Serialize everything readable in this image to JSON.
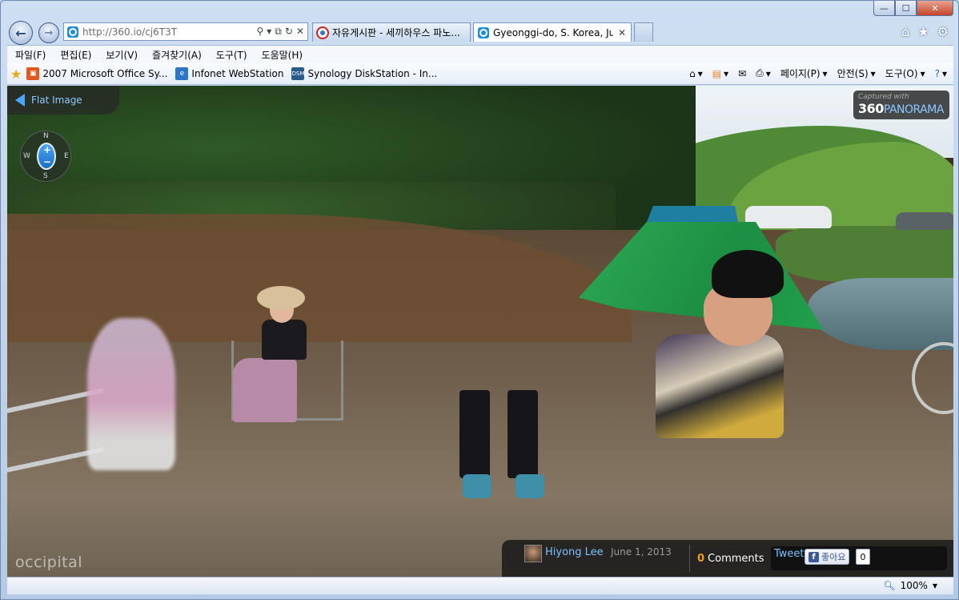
{
  "window": {
    "minimize_glyph": "—",
    "maximize_glyph": "☐",
    "close_glyph": "✕"
  },
  "nav": {
    "url": "http://360.io/cj6T3T",
    "back_glyph": "←",
    "forward_glyph": "→"
  },
  "tabs": [
    {
      "label": "자유게시판 - 세끼하우스 파노...",
      "active": false
    },
    {
      "label": "Gyeonggi-do, S. Korea, Jun...",
      "active": true
    }
  ],
  "menu": [
    "파일(F)",
    "편집(E)",
    "보기(V)",
    "즐겨찾기(A)",
    "도구(T)",
    "도움말(H)"
  ],
  "favorites": [
    {
      "label": "2007 Microsoft Office Sy...",
      "icon": "office-icon",
      "color": "#e2571e"
    },
    {
      "label": "Infonet WebStation",
      "icon": "ie-icon",
      "color": "#2a77c9"
    },
    {
      "label": "Synology DiskStation - In...",
      "icon": "dsm-icon",
      "color": "#2a5a8a"
    }
  ],
  "command_bar": {
    "page": "페이지(P)",
    "safety": "안전(S)",
    "tools": "도구(O)"
  },
  "panorama": {
    "flat_image": "Flat Image",
    "brand_caption": "Captured with",
    "brand_number": "360",
    "brand_word": "PANORAMA",
    "compass": {
      "n": "N",
      "s": "S",
      "w": "W",
      "e": "E"
    },
    "zoom_in": "+",
    "zoom_out": "−",
    "watermark": "occipital"
  },
  "footer": {
    "author": "Hiyong Lee",
    "date": "June 1, 2013",
    "comment_count": "0",
    "comments_label": "Comments",
    "tweet": "Tweet",
    "like_label": "좋아요",
    "like_count": "0"
  },
  "status": {
    "zoom": "100%"
  },
  "colors": {
    "accent": "#4aa6ff",
    "comment_count": "#f39c1f",
    "facebook": "#3b5998"
  }
}
